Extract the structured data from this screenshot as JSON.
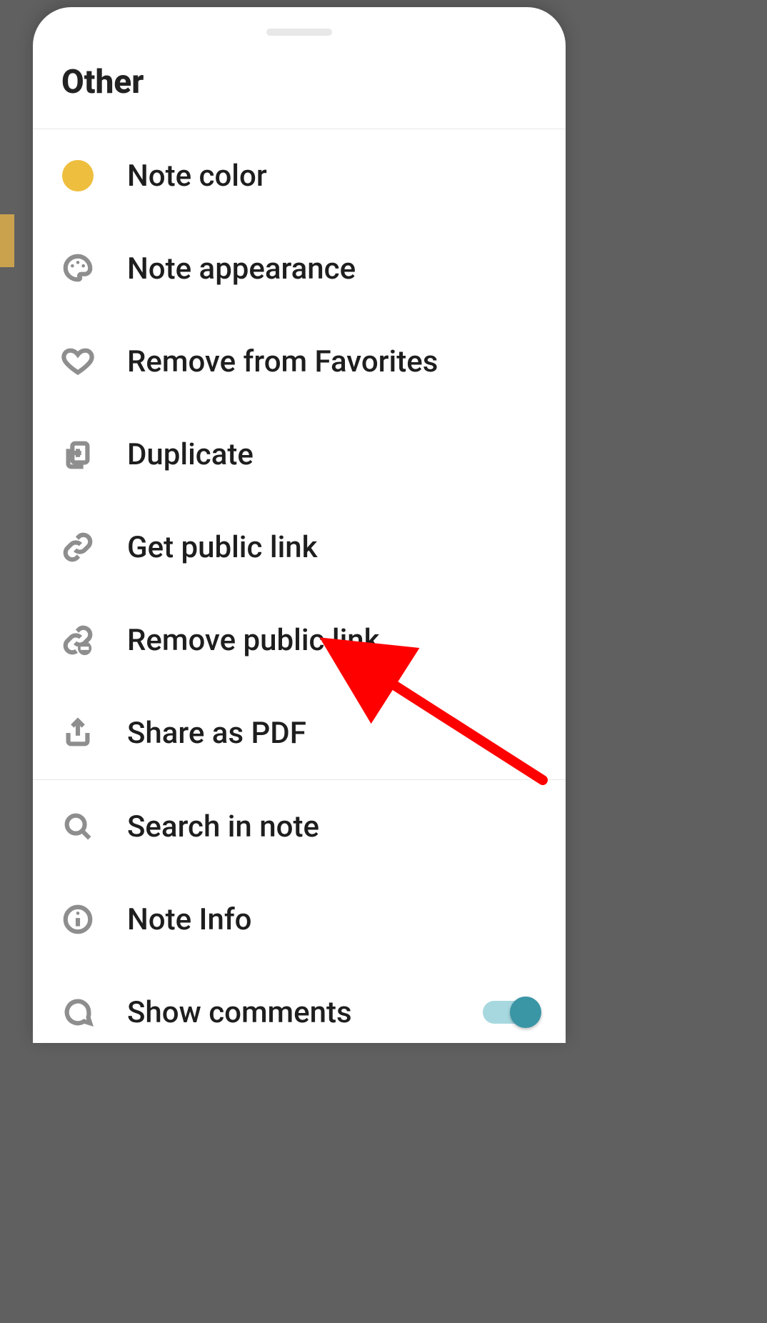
{
  "sheet": {
    "title": "Other",
    "note_color_hex": "#eebe3e"
  },
  "menu": {
    "note_color": "Note color",
    "note_appearance": "Note appearance",
    "remove_favorites": "Remove from Favorites",
    "duplicate": "Duplicate",
    "get_public_link": "Get public link",
    "remove_public_link": "Remove public link",
    "share_pdf": "Share as PDF",
    "search_in_note": "Search in note",
    "note_info": "Note Info",
    "show_comments": "Show comments"
  },
  "toggles": {
    "show_comments_on": true
  },
  "annotation": {
    "type": "arrow",
    "points_to": "remove_public_link",
    "color": "#ff0000"
  }
}
